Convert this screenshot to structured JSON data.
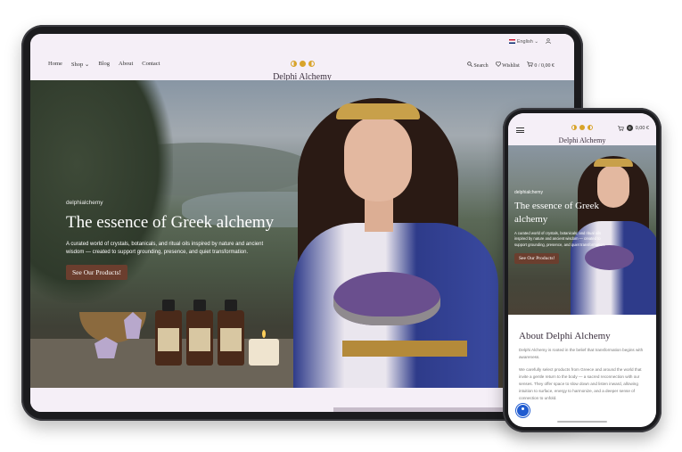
{
  "tablet": {
    "topbar": {
      "language": "English",
      "language_caret": "⌄",
      "user_icon": "user-icon"
    },
    "nav": [
      "Home",
      "Shop",
      "Blog",
      "About",
      "Contact"
    ],
    "shop_caret": "⌄",
    "logo_text": "Delphi Alchemy",
    "right": {
      "search": "Search",
      "wishlist": "Wishlist",
      "cart": "0 / 0,00 €"
    },
    "hero": {
      "kicker": "delphialchemy",
      "title": "The essence of Greek alchemy",
      "description": "A curated world of crystals, botanicals, and ritual oils inspired by nature and ancient wisdom — created to support grounding, presence, and quiet transformation.",
      "button": "See Our Products!"
    }
  },
  "phone": {
    "logo_text": "Delphi Alchemy",
    "cart_count": "0",
    "cart_total": "0,00 €",
    "hero": {
      "kicker": "delphialchemy",
      "title": "The essence of Greek alchemy",
      "description": "A curated world of crystals, botanicals, and ritual oils inspired by nature and ancient wisdom — created to support grounding, presence, and quiet transformation.",
      "button": "See Our Products!"
    },
    "about": {
      "title": "About Delphi Alchemy",
      "p1": "Delphi Alchemy is rooted in the belief that transformation begins with awareness.",
      "p2": "We carefully select products from Greece and around the world that invite a gentle return to the body — a sacred reconnection with our senses. They offer space to slow down and listen inward, allowing intuition to surface, energy to harmonize, and a deeper sense of connection to unfold."
    }
  },
  "colors": {
    "accent_button": "#6b3e2e",
    "gold": "#d8a42a",
    "background": "#f6f0f7"
  }
}
